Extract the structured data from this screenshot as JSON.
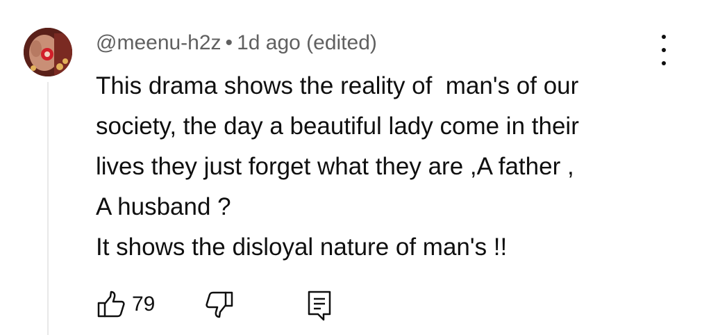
{
  "comment": {
    "author": "@meenu-h2z",
    "separator": "•",
    "timestamp": "1d ago (edited)",
    "lines": [
      "This drama shows the reality of  man's of our",
      "society, the day a beautiful lady come in their",
      "lives they just forget what they are ,A father ,",
      "A husband ?",
      "It shows the disloyal nature of man's !!"
    ],
    "like_count": "79"
  },
  "icons": {
    "like": "thumbs-up-icon",
    "dislike": "thumbs-down-icon",
    "reply": "reply-comment-icon",
    "more": "more-vertical-icon"
  },
  "colors": {
    "text_primary": "#0f0f0f",
    "text_secondary": "#606060",
    "thread_line": "#e8e8e8"
  }
}
